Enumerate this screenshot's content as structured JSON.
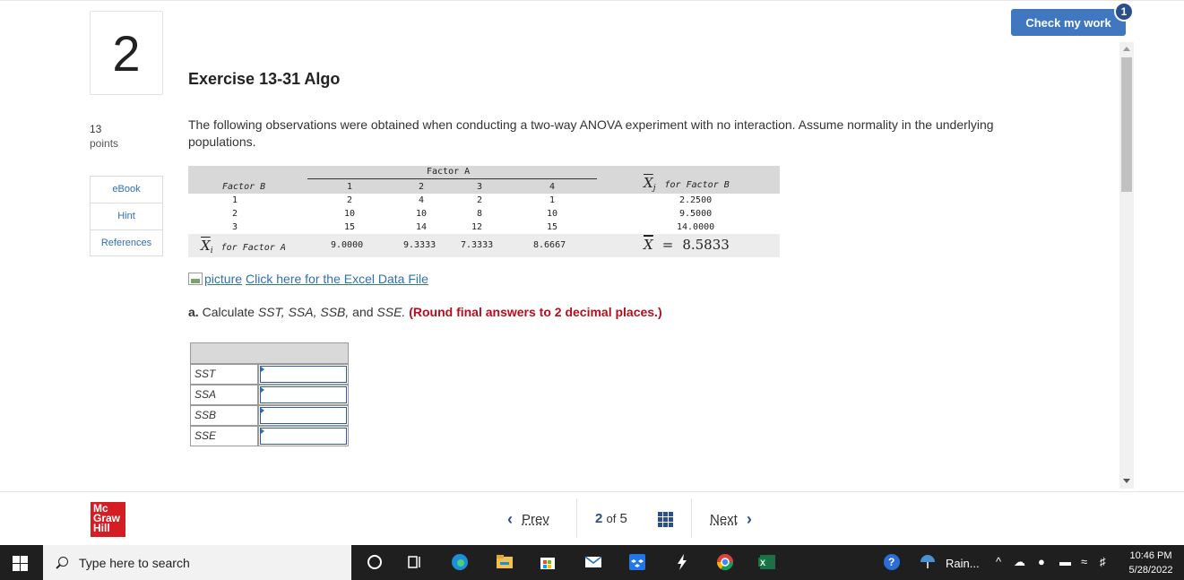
{
  "question": {
    "number": "2",
    "title": "Exercise 13-31 Algo",
    "points_value": "13",
    "points_label": "points",
    "text": "The following observations were obtained when conducting a two-way ANOVA experiment with no interaction. Assume normality in the underlying populations."
  },
  "side_buttons": [
    "eBook",
    "Hint",
    "References"
  ],
  "check_button": {
    "label": "Check my work",
    "badge": "1"
  },
  "data_table": {
    "factor_a_label": "Factor A",
    "factor_b_label": "Factor B",
    "columns": [
      "1",
      "2",
      "3",
      "4"
    ],
    "rows": [
      {
        "label": "1",
        "values": [
          "2",
          "4",
          "2",
          "1"
        ],
        "mean": "2.2500"
      },
      {
        "label": "2",
        "values": [
          "10",
          "10",
          "8",
          "10"
        ],
        "mean": "9.5000"
      },
      {
        "label": "3",
        "values": [
          "15",
          "14",
          "12",
          "15"
        ],
        "mean": "14.0000"
      }
    ],
    "col_means_label": "for Factor A",
    "col_means": [
      "9.0000",
      "9.3333",
      "7.3333",
      "8.6667"
    ],
    "row_mean_label": "for Factor B",
    "grand_mean_eq": "=",
    "grand_mean": "8.5833",
    "xi_sym": "X",
    "xi_sub": "i",
    "xj_sym": "X",
    "xj_sub": "j",
    "xbar_sym": "X"
  },
  "excel_link": {
    "alt": "picture",
    "text": "Click here for the Excel Data File"
  },
  "part_a": {
    "prefix": "a. ",
    "text_before": "Calculate ",
    "terms": "SST, SSA, SSB,",
    "and": " and ",
    "last_term": "SSE.",
    "instruction": " (Round final answers to 2 decimal places.)"
  },
  "answer_rows": [
    {
      "label": "SST",
      "value": ""
    },
    {
      "label": "SSA",
      "value": ""
    },
    {
      "label": "SSB",
      "value": ""
    },
    {
      "label": "SSE",
      "value": ""
    }
  ],
  "footer": {
    "logo": [
      "Mc",
      "Graw",
      "Hill"
    ],
    "prev": "Prev",
    "page_current": "2",
    "page_of": "of",
    "page_total": "5",
    "next": "Next"
  },
  "taskbar": {
    "search_placeholder": "Type here to search",
    "weather": "Rain...",
    "time": "10:46 PM",
    "date": "5/28/2022"
  },
  "colors": {
    "accent": "#3f78c0",
    "link": "#2f6fb3",
    "red_instruction": "#b80d1c",
    "logo_red": "#d41e24"
  }
}
